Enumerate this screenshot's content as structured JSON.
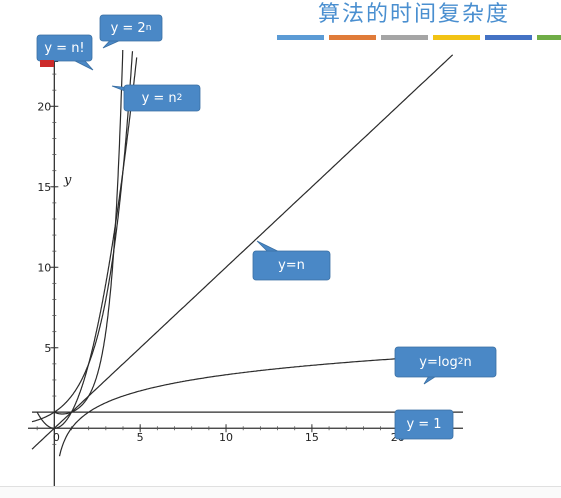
{
  "header": {
    "title": "算法的时间复杂度",
    "top_text": "",
    "accent_bars": [
      "#5b9bd5",
      "#e07b39",
      "#a5a5a5",
      "#f2c314",
      "#4472c4",
      "#70ad47"
    ]
  },
  "chart_data": {
    "type": "line",
    "title": "",
    "xlabel": "",
    "ylabel": "y",
    "xlim": [
      -1.3,
      23.8
    ],
    "ylim": [
      -1.6,
      23
    ],
    "x_ticks": [
      0,
      5,
      10,
      15,
      20
    ],
    "x_tick_labels": [
      "0",
      "5",
      "10",
      "15",
      "20"
    ],
    "y_ticks": [
      5,
      10,
      15,
      20
    ],
    "y_tick_labels": [
      "5",
      "10",
      "15",
      "20"
    ],
    "grid": false,
    "series": [
      {
        "name": "y = 1",
        "label_html": "y = 1",
        "function": "constant",
        "x": [
          -1.3,
          23.8
        ],
        "y": [
          1,
          1
        ]
      },
      {
        "name": "y=log2n",
        "label_html": "y=log<sub>2</sub>n",
        "function": "log2",
        "x": [
          0.3,
          0.5,
          1,
          2,
          4,
          8,
          16,
          23.8
        ],
        "y": [
          -1.74,
          -1,
          0,
          1,
          2,
          3,
          4,
          4.57
        ]
      },
      {
        "name": "y=n",
        "label_html": "y=n",
        "function": "linear",
        "x": [
          -1.3,
          23
        ],
        "y": [
          -1.3,
          23
        ]
      },
      {
        "name": "y = n2",
        "label_html": "y = n<sup>2</sup>",
        "function": "square",
        "x": [
          -1,
          0,
          1,
          2,
          3,
          4,
          4.7
        ],
        "y": [
          1,
          0,
          1,
          4,
          9,
          16,
          22.1
        ]
      },
      {
        "name": "y = 2n",
        "label_html": "y = 2<sup>n</sup>",
        "function": "exp2",
        "x": [
          -1.3,
          0,
          1,
          2,
          3,
          4,
          4.5
        ],
        "y": [
          0.41,
          1,
          2,
          4,
          8,
          16,
          22.6
        ]
      },
      {
        "name": "y = n!",
        "label_html": "y = n!",
        "function": "factorial",
        "x": [
          0,
          1,
          2,
          3,
          4
        ],
        "y": [
          1,
          1,
          2,
          6,
          24
        ]
      }
    ]
  }
}
